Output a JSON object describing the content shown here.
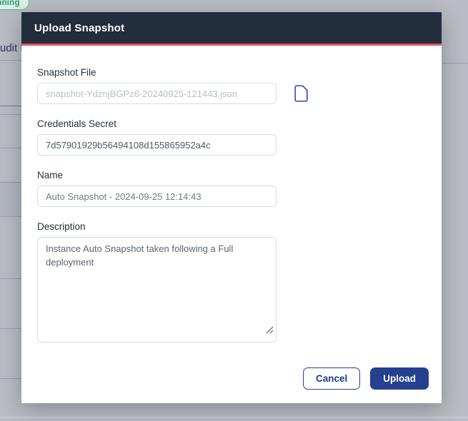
{
  "background": {
    "status_badge": "running",
    "page_heading_fragment": "udit L"
  },
  "modal": {
    "title": "Upload Snapshot",
    "fields": {
      "snapshot_file": {
        "label": "Snapshot File",
        "placeholder": "snapshot-YdznjBGPz6-20240925-121443.json",
        "icon": "file-icon"
      },
      "credentials_secret": {
        "label": "Credentials Secret",
        "value": "7d57901929b56494108d155865952a4c"
      },
      "name": {
        "label": "Name",
        "value": "Auto Snapshot - 2024-09-25 12:14:43"
      },
      "description": {
        "label": "Description",
        "value": "Instance Auto Snapshot taken following a Full deployment"
      }
    },
    "buttons": {
      "cancel": "Cancel",
      "upload": "Upload"
    }
  },
  "colors": {
    "header_bg": "#222d3e",
    "accent_red": "#e8535a",
    "primary_blue": "#24408f",
    "icon_blue": "#3a52b8",
    "badge_green": "#2f9e77",
    "backdrop": "#b9bcc2"
  }
}
